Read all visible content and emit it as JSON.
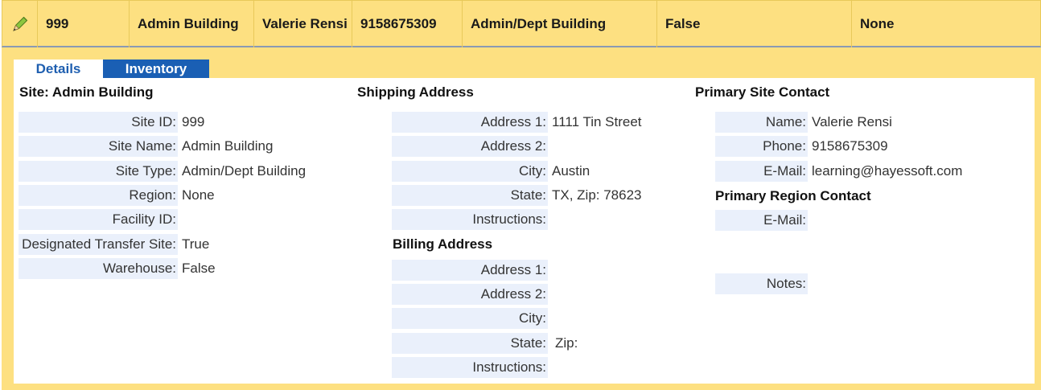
{
  "summary": {
    "site_id": "999",
    "site_name": "Admin Building",
    "contact_name": "Valerie Rensi",
    "phone": "9158675309",
    "site_type": "Admin/Dept Building",
    "warehouse": "False",
    "region": "None"
  },
  "tabs": {
    "details": "Details",
    "inventory": "Inventory"
  },
  "site": {
    "heading": "Site: Admin Building",
    "fields": [
      {
        "label": "Site ID:",
        "value": "999"
      },
      {
        "label": "Site Name:",
        "value": "Admin Building"
      },
      {
        "label": "Site Type:",
        "value": "Admin/Dept Building"
      },
      {
        "label": "Region:",
        "value": "None"
      },
      {
        "label": "Facility ID:",
        "value": ""
      },
      {
        "label": "Designated Transfer Site:",
        "value": "True"
      },
      {
        "label": "Warehouse:",
        "value": "False"
      }
    ]
  },
  "shipping": {
    "heading": "Shipping Address",
    "fields": [
      {
        "label": "Address 1:",
        "value": "1111 Tin Street"
      },
      {
        "label": "Address 2:",
        "value": ""
      },
      {
        "label": "City:",
        "value": "Austin"
      },
      {
        "label": "State:",
        "value": "TX, Zip: 78623"
      },
      {
        "label": "Instructions:",
        "value": ""
      }
    ]
  },
  "billing": {
    "heading": "Billing Address",
    "fields": [
      {
        "label": "Address 1:",
        "value": ""
      },
      {
        "label": "Address 2:",
        "value": ""
      },
      {
        "label": "City:",
        "value": ""
      },
      {
        "label": "State:",
        "value": " Zip:"
      },
      {
        "label": "Instructions:",
        "value": ""
      }
    ]
  },
  "primary_site_contact": {
    "heading": "Primary Site Contact",
    "fields": [
      {
        "label": "Name:",
        "value": "Valerie Rensi"
      },
      {
        "label": "Phone:",
        "value": "9158675309"
      },
      {
        "label": "E-Mail:",
        "value": "learning@hayessoft.com"
      }
    ]
  },
  "primary_region_contact": {
    "heading": "Primary Region Contact",
    "fields": [
      {
        "label": "E-Mail:",
        "value": ""
      }
    ]
  },
  "notes": {
    "label": "Notes:",
    "value": ""
  },
  "colors": {
    "header_bg": "#fde081",
    "tab_active_text": "#1f5fb0",
    "tab_inactive_bg": "#1a5fb4",
    "label_bg": "#eaf0fb"
  }
}
